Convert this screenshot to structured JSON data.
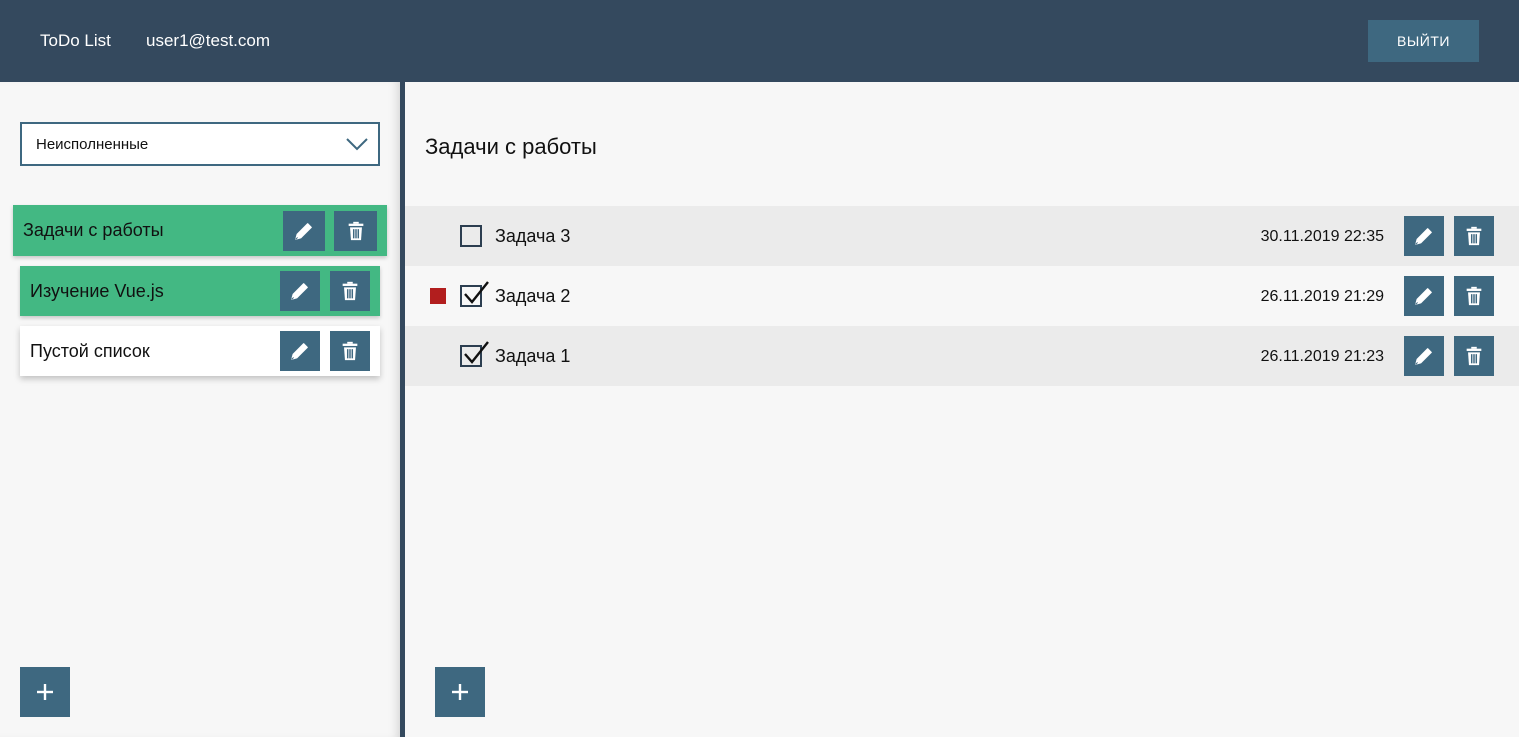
{
  "header": {
    "app_title": "ToDo List",
    "user_email": "user1@test.com",
    "logout_label": "ВЫЙТИ"
  },
  "sidebar": {
    "filter": {
      "selected": "Неисполненные"
    },
    "lists": [
      {
        "name": "Задачи с работы",
        "state": "active",
        "color": "#43b883"
      },
      {
        "name": "Изучение Vue.js",
        "state": "highlighted",
        "color": "#43b883"
      },
      {
        "name": "Пустой список",
        "state": "normal",
        "color": "#ffffff"
      }
    ],
    "add_icon": "plus-icon"
  },
  "main": {
    "title": "Задачи с работы",
    "tasks": [
      {
        "name": "Задача 3",
        "date": "30.11.2019 22:35",
        "checked": false,
        "priority": false
      },
      {
        "name": "Задача 2",
        "date": "26.11.2019 21:29",
        "checked": true,
        "priority": true
      },
      {
        "name": "Задача 1",
        "date": "26.11.2019 21:23",
        "checked": true,
        "priority": false
      }
    ],
    "add_icon": "plus-icon"
  },
  "icons": {
    "edit": "pencil-icon",
    "delete": "trash-icon",
    "dropdown": "chevron-down-icon"
  },
  "colors": {
    "header_bg": "#34495e",
    "button_bg": "#3e6880",
    "list_active": "#43b883",
    "priority_high": "#b21e1e"
  }
}
